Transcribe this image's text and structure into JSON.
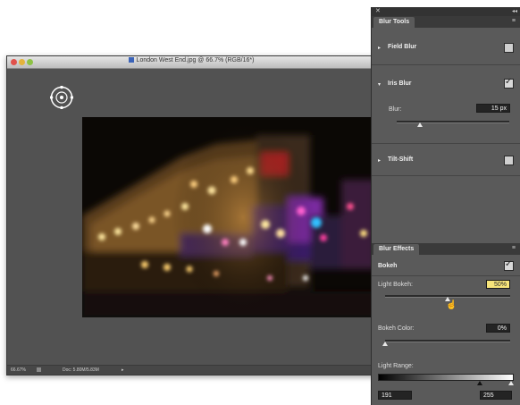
{
  "document": {
    "title": "London West End.jpg @ 66.7% (RGB/16*)",
    "zoom": "66.67%",
    "doc_size": "Doc: 5.80M/5.83M",
    "status_arrow": "▸"
  },
  "panel": {
    "close": "✕",
    "collapse": "◂◂",
    "menu": "≡",
    "blur_tools": {
      "tab": "Blur Tools",
      "field_blur": {
        "label": "Field Blur",
        "checked": false
      },
      "iris_blur": {
        "label": "Iris Blur",
        "checked": true,
        "blur_label": "Blur:",
        "blur_value": "15 px"
      },
      "tilt_shift": {
        "label": "Tilt-Shift",
        "checked": false
      }
    },
    "blur_effects": {
      "tab": "Blur Effects",
      "bokeh": {
        "label": "Bokeh",
        "checked": true
      },
      "light_bokeh": {
        "label": "Light Bokeh:",
        "value": "50%"
      },
      "bokeh_color": {
        "label": "Bokeh Color:",
        "value": "0%"
      },
      "light_range": {
        "label": "Light Range:",
        "low": "191",
        "high": "255"
      }
    }
  },
  "icons": {
    "expand": "▸",
    "collapse_section": "▾",
    "check": "✓",
    "cursor": "pointer-hand"
  }
}
